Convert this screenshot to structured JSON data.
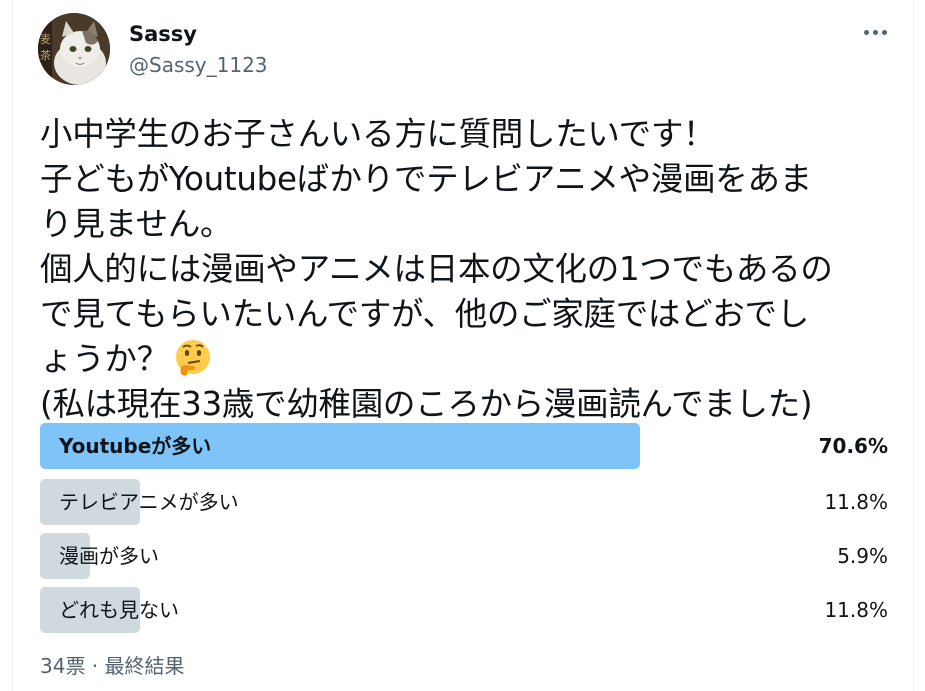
{
  "tweet": {
    "author_name": "Sassy",
    "author_handle": "@Sassy_1123",
    "text": "小中学生のお子さんいる方に質問したいです！\n子どもがYoutubeばかりでテレビアニメや漫画をあま\nり見ません。\n個人的には漫画やアニメは日本の文化の1つでもあるの\nで見てもらいたいんですが、他のご家庭ではどおでし\nょうか？",
    "text_after_emoji": "\n(私は現在33歳で幼稚園のころから漫画読んでました)",
    "emoji": "thinking-face-icon",
    "avatar_icon": "cat-avatar-icon",
    "more_icon": "more-options-icon"
  },
  "poll": {
    "options": [
      {
        "label": "Youtubeが多い",
        "percent_text": "70.6%",
        "percent": 70.6,
        "winner": true
      },
      {
        "label": "テレビアニメが多い",
        "percent_text": "11.8%",
        "percent": 11.8,
        "winner": false
      },
      {
        "label": "漫画が多い",
        "percent_text": "5.9%",
        "percent": 5.9,
        "winner": false
      },
      {
        "label": "どれも見ない",
        "percent_text": "11.8%",
        "percent": 11.8,
        "winner": false
      }
    ],
    "footer": "34票 · 最終結果"
  },
  "colors": {
    "winner_bar": "#7fc4f8",
    "other_bar": "#cfd9de",
    "secondary_text": "#536471",
    "primary_text": "#0f1419"
  }
}
